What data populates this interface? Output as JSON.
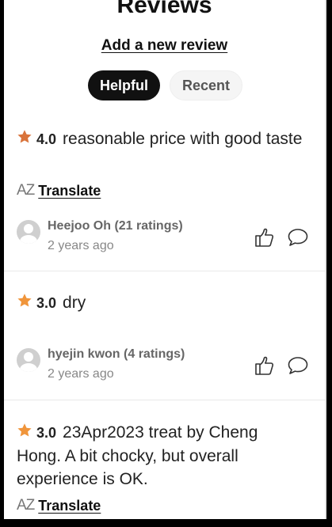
{
  "header": {
    "title": "Reviews",
    "add_review": "Add a new review"
  },
  "tabs": [
    {
      "label": "Helpful",
      "active": true
    },
    {
      "label": "Recent",
      "active": false
    }
  ],
  "reviews": [
    {
      "rating": "4.0",
      "text": "reasonable price with good taste",
      "translate": "Translate",
      "translate_icon": "AZ",
      "user": "Heejoo Oh (21 ratings)",
      "time": "2 years ago",
      "star_color": "#d9733b"
    },
    {
      "rating": "3.0",
      "text": "dry",
      "user": "hyejin kwon (4 ratings)",
      "time": "2 years ago",
      "star_color": "#f0953b"
    },
    {
      "rating": "3.0",
      "text": "23Apr2023 treat by Cheng Hong. A bit chocky, but overall experience is OK.",
      "translate": "Translate",
      "translate_icon": "AZ",
      "star_color": "#f0953b"
    }
  ],
  "icons": {
    "star": "star-icon",
    "like": "thumbs-up-icon",
    "comment": "comment-icon",
    "translate": "translate-icon",
    "avatar": "avatar-icon"
  }
}
